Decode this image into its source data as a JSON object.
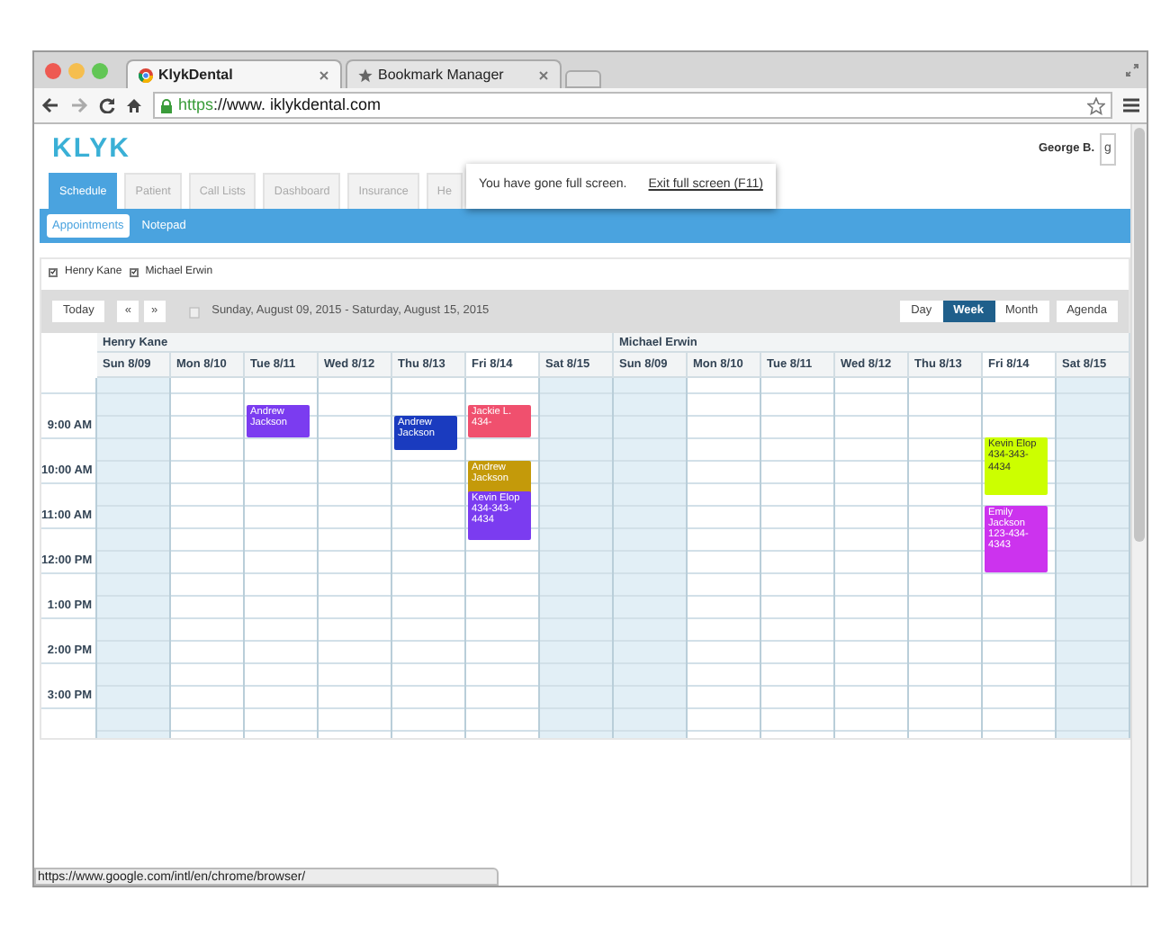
{
  "browser": {
    "tabs": [
      {
        "title": "KlykDental",
        "selected": true
      },
      {
        "title": "Bookmark Manager",
        "selected": false
      }
    ],
    "url": {
      "scheme": "https",
      "rest": "://www. iklykdental.com"
    },
    "status_url": "https://www.google.com/intl/en/chrome/browser/"
  },
  "app": {
    "logo": "KLYK",
    "user": "George B.",
    "user_button": "g",
    "tabs": [
      {
        "label": "Schedule",
        "selected": true
      },
      {
        "label": "Patient",
        "selected": false
      },
      {
        "label": "Call Lists",
        "selected": false
      },
      {
        "label": "Dashboard",
        "selected": false
      },
      {
        "label": "Insurance",
        "selected": false
      },
      {
        "label": "He",
        "selected": false
      }
    ],
    "subtabs": [
      {
        "label": "Appointments",
        "selected": true
      },
      {
        "label": "Notepad",
        "selected": false
      }
    ]
  },
  "fullscreen_notice": {
    "message": "You have gone full screen.",
    "link": "Exit full screen (F11)"
  },
  "providers": [
    {
      "name": "Henry Kane",
      "checked": true
    },
    {
      "name": "Michael Erwin",
      "checked": true
    }
  ],
  "toolbar": {
    "today": "Today",
    "prev": "«",
    "next": "»",
    "range": "Sunday, August 09, 2015 - Saturday, August 15, 2015",
    "views": [
      {
        "label": "Day",
        "selected": false
      },
      {
        "label": "Week",
        "selected": true
      },
      {
        "label": "Month",
        "selected": false
      },
      {
        "label": "Agenda",
        "selected": false
      }
    ]
  },
  "calendar": {
    "times": [
      "9:00 AM",
      "10:00 AM",
      "11:00 AM",
      "12:00 PM",
      "1:00 PM",
      "2:00 PM",
      "3:00 PM"
    ],
    "resources": [
      {
        "name": "Henry Kane",
        "days": [
          {
            "label": "Sun 8/09",
            "weekend": true,
            "today": false
          },
          {
            "label": "Mon 8/10",
            "weekend": false,
            "today": false
          },
          {
            "label": "Tue 8/11",
            "weekend": false,
            "today": false,
            "events": [
              {
                "name": "Andrew Jackson",
                "color": "#7b3cf0"
              }
            ]
          },
          {
            "label": "Wed 8/12",
            "weekend": false,
            "today": false
          },
          {
            "label": "Thu 8/13",
            "weekend": false,
            "today": false,
            "events": [
              {
                "name": "Andrew Jackson",
                "color": "#1a3bbf"
              }
            ]
          },
          {
            "label": "Fri 8/14",
            "weekend": false,
            "today": true,
            "events": [
              {
                "name": "Jackie L.",
                "phone": "434-",
                "color": "#f0506e"
              },
              {
                "name": "Andrew Jackson",
                "color": "#c49a0a"
              },
              {
                "name": "Kevin Elop",
                "phone": "434-343-4434",
                "color": "#7b3cf0"
              }
            ]
          },
          {
            "label": "Sat 8/15",
            "weekend": true,
            "today": false
          }
        ]
      },
      {
        "name": "Michael Erwin",
        "days": [
          {
            "label": "Sun 8/09",
            "weekend": true,
            "today": false
          },
          {
            "label": "Mon 8/10",
            "weekend": false,
            "today": false
          },
          {
            "label": "Tue 8/11",
            "weekend": false,
            "today": false
          },
          {
            "label": "Wed 8/12",
            "weekend": false,
            "today": false
          },
          {
            "label": "Thu 8/13",
            "weekend": false,
            "today": false
          },
          {
            "label": "Fri 8/14",
            "weekend": false,
            "today": true,
            "events": [
              {
                "name": "Kevin Elop",
                "phone": "434-343-4434",
                "color": "#ccff00"
              },
              {
                "name": "Emily Jackson",
                "phone": "123-434-4343",
                "color": "#cc33ee"
              }
            ]
          },
          {
            "label": "Sat 8/15",
            "weekend": true,
            "today": false
          }
        ]
      }
    ]
  }
}
